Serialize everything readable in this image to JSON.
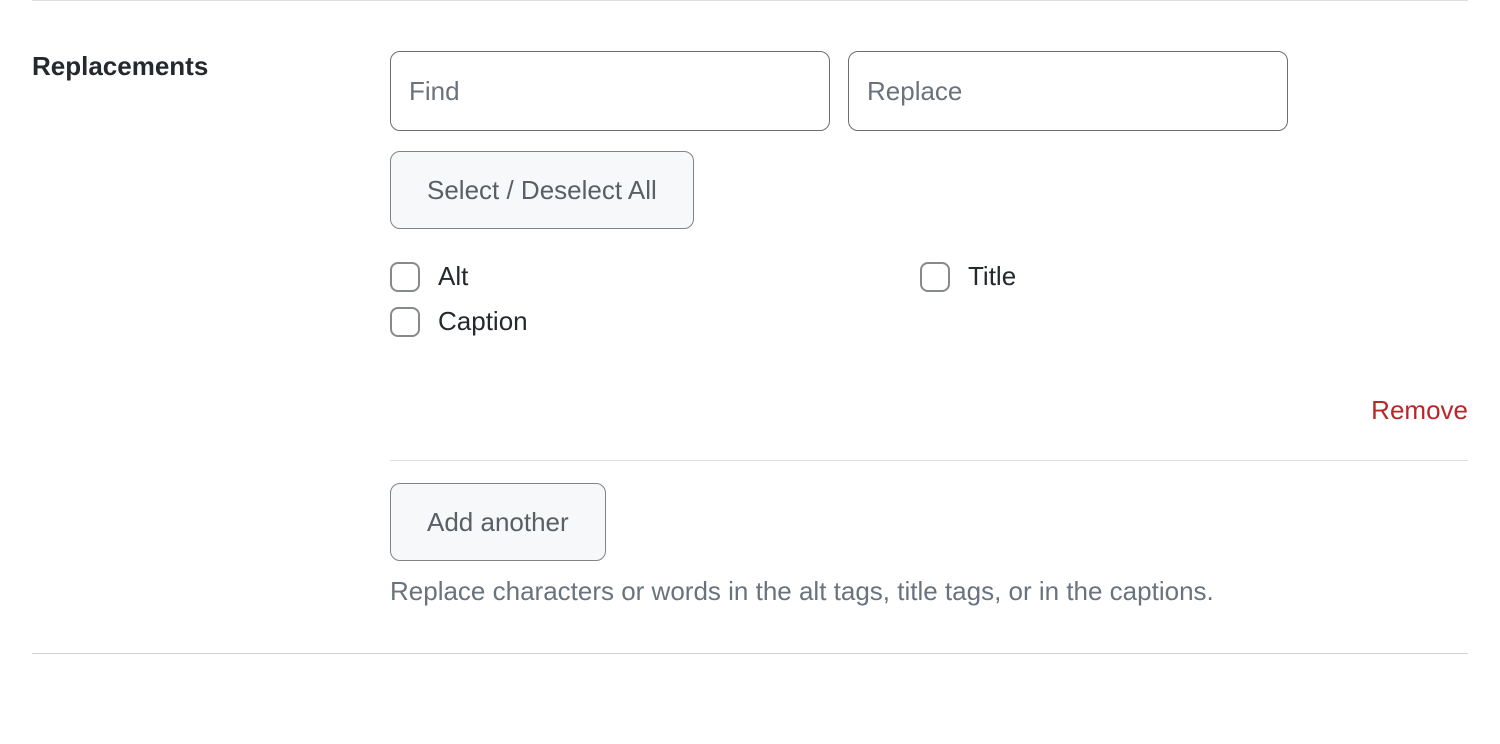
{
  "section": {
    "label": "Replacements"
  },
  "inputs": {
    "find_placeholder": "Find",
    "find_value": "",
    "replace_placeholder": "Replace",
    "replace_value": ""
  },
  "buttons": {
    "select_deselect_all": "Select / Deselect All",
    "add_another": "Add another"
  },
  "checkboxes": {
    "alt": "Alt",
    "title": "Title",
    "caption": "Caption"
  },
  "links": {
    "remove": "Remove"
  },
  "help": {
    "text": "Replace characters or words in the alt tags, title tags, or in the captions."
  }
}
